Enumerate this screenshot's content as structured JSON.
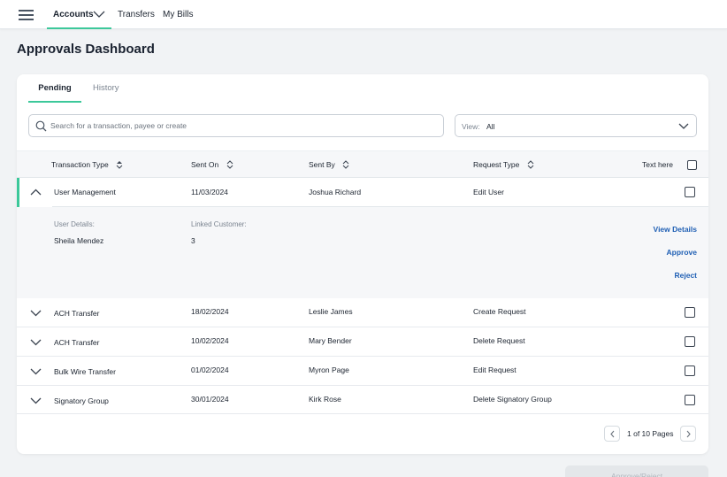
{
  "nav": {
    "accounts": "Accounts",
    "transfers": "Transfers",
    "my_bills": "My Bills"
  },
  "page_title": "Approvals Dashboard",
  "tabs": {
    "pending": "Pending",
    "history": "History"
  },
  "search": {
    "placeholder": "Search for a transaction, payee or create",
    "value": ""
  },
  "view_filter": {
    "label": "View:",
    "value": "All"
  },
  "table": {
    "headers": {
      "transaction_type": "Transaction Type",
      "sent_on": "Sent On",
      "sent_by": "Sent By",
      "request_type": "Request Type",
      "select_all": "Text here"
    },
    "rows": [
      {
        "transaction_type": "User Management",
        "sent_on": "11/03/2024",
        "sent_by": "Joshua Richard",
        "request_type": "Edit User",
        "expanded": true,
        "checked": false
      },
      {
        "transaction_type": "ACH Transfer",
        "sent_on": "18/02/2024",
        "sent_by": "Leslie James",
        "request_type": "Create Request",
        "expanded": false,
        "checked": false
      },
      {
        "transaction_type": "ACH Transfer",
        "sent_on": "10/02/2024",
        "sent_by": "Mary Bender",
        "request_type": "Delete Request",
        "expanded": false,
        "checked": false
      },
      {
        "transaction_type": "Bulk Wire Transfer",
        "sent_on": "01/02/2024",
        "sent_by": "Myron Page",
        "request_type": "Edit Request",
        "expanded": false,
        "checked": false
      },
      {
        "transaction_type": "Signatory Group",
        "sent_on": "30/01/2024",
        "sent_by": "Kirk Rose",
        "request_type": "Delete Signatory Group",
        "expanded": false,
        "checked": false
      }
    ]
  },
  "details": {
    "user_details_label": "User Details:",
    "user_details_value": "Sheila Mendez",
    "linked_customer_label": "Linked Customer:",
    "linked_customer_value": "3",
    "view_details": "View Details",
    "approve": "Approve",
    "reject": "Reject"
  },
  "pagination": {
    "text": "1 of 10 Pages"
  },
  "footer": {
    "approve_reject_label": "Approve/Reject"
  },
  "colors": {
    "accent": "#3cc89a",
    "link": "#1f5fb4",
    "background": "#f1f3f5"
  }
}
